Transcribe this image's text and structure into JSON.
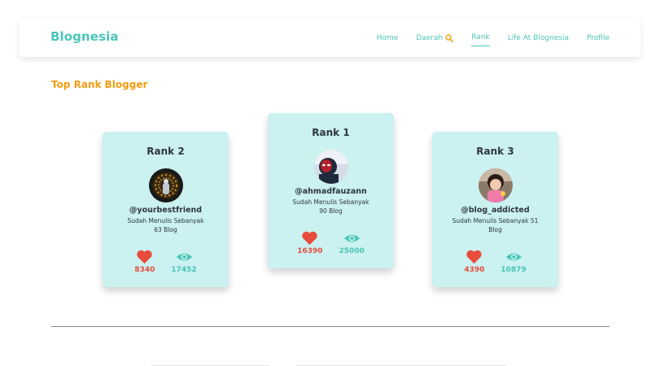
{
  "brand": "Blognesia",
  "nav": {
    "home": "Home",
    "daerah": "Daerah",
    "rank": "Rank",
    "life": "Life At Blognesia",
    "profile": "Profile"
  },
  "section_title": "Top Rank Blogger",
  "cards": [
    {
      "rank": "Rank 2",
      "username": "@yourbestfriend",
      "blog_line1": "Sudah Menulis Sebanyak",
      "blog_line2": "63 Blog",
      "likes": "8340",
      "views": "17452"
    },
    {
      "rank": "Rank 1",
      "username": "@ahmadfauzann",
      "blog_line1": "Sudah Menulis Sebanyak",
      "blog_line2": "90 Blog",
      "likes": "16390",
      "views": "25000"
    },
    {
      "rank": "Rank 3",
      "username": "@blog_addicted",
      "blog_line1": "Sudah Menulis Sebanyak 51",
      "blog_line2": "Blog",
      "likes": "4390",
      "views": "10879"
    }
  ],
  "icons": {
    "heart": "heart-icon",
    "eye": "eye-icon",
    "search": "search-icon"
  },
  "colors": {
    "brand": "#4ac6b7",
    "accent": "#f39c12",
    "card": "#cbf1f1",
    "like": "#e74c3c"
  }
}
